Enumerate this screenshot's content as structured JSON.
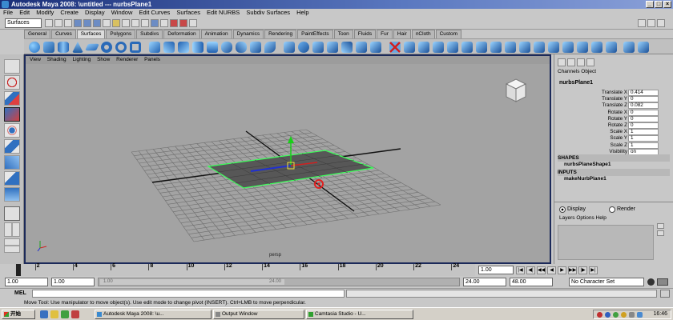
{
  "window": {
    "title": "Autodesk Maya 2008: \\untitled    ---    nurbsPlane1"
  },
  "menubar": [
    "File",
    "Edit",
    "Modify",
    "Create",
    "Display",
    "Window",
    "Edit Curves",
    "Surfaces",
    "Edit NURBS",
    "Subdiv Surfaces",
    "Help"
  ],
  "status": {
    "mode": "Surfaces"
  },
  "shelf": {
    "tabs": [
      "General",
      "Curves",
      "Surfaces",
      "Polygons",
      "Subdivs",
      "Deformation",
      "Animation",
      "Dynamics",
      "Rendering",
      "PaintEffects",
      "Toon",
      "Fluids",
      "Fur",
      "Hair",
      "nCloth",
      "Custom"
    ],
    "active": "Surfaces"
  },
  "viewport": {
    "menu": [
      "View",
      "Shading",
      "Lighting",
      "Show",
      "Renderer",
      "Panels"
    ],
    "camera_label": "persp"
  },
  "channel_box": {
    "tabs": [
      "Channels",
      "Object"
    ],
    "object_name": "nurbsPlane1",
    "attributes": [
      {
        "name": "Translate X",
        "value": "0.414"
      },
      {
        "name": "Translate Y",
        "value": "0"
      },
      {
        "name": "Translate Z",
        "value": "0.082"
      },
      {
        "name": "Rotate X",
        "value": "0"
      },
      {
        "name": "Rotate Y",
        "value": "0"
      },
      {
        "name": "Rotate Z",
        "value": "0"
      },
      {
        "name": "Scale X",
        "value": "1"
      },
      {
        "name": "Scale Y",
        "value": "1"
      },
      {
        "name": "Scale Z",
        "value": "1"
      },
      {
        "name": "Visibility",
        "value": "on"
      }
    ],
    "shapes_header": "SHAPES",
    "shape_name": "nurbsPlaneShape1",
    "inputs_header": "INPUTS",
    "input_name": "makeNurbPlane1"
  },
  "layer_editor": {
    "display_label": "Display",
    "render_label": "Render",
    "menu": [
      "Layers",
      "Options",
      "Help"
    ]
  },
  "time_slider": {
    "ticks": [
      "2",
      "4",
      "6",
      "8",
      "10",
      "12",
      "14",
      "16",
      "18",
      "20",
      "22",
      "24"
    ],
    "current_frame": "1.00"
  },
  "range_slider": {
    "start": "1.00",
    "inner_start": "1.00",
    "range_label_left": "1.00",
    "range_label_right": "24.00",
    "end": "24.00",
    "outer_end": "48.00",
    "character_set": "No Character Set"
  },
  "command_line": {
    "label": "MEL"
  },
  "help_line": {
    "text": "Move Tool: Use manipulator to move object(s). Use edit mode to change pivot (INSERT). Ctrl+LMB to move perpendicular."
  },
  "taskbar": {
    "start_label": "开始",
    "tasks": [
      "Autodesk Maya 2008: \\u...",
      "Output Window",
      "Camtasia Studio - U..."
    ],
    "clock": "16:46"
  }
}
